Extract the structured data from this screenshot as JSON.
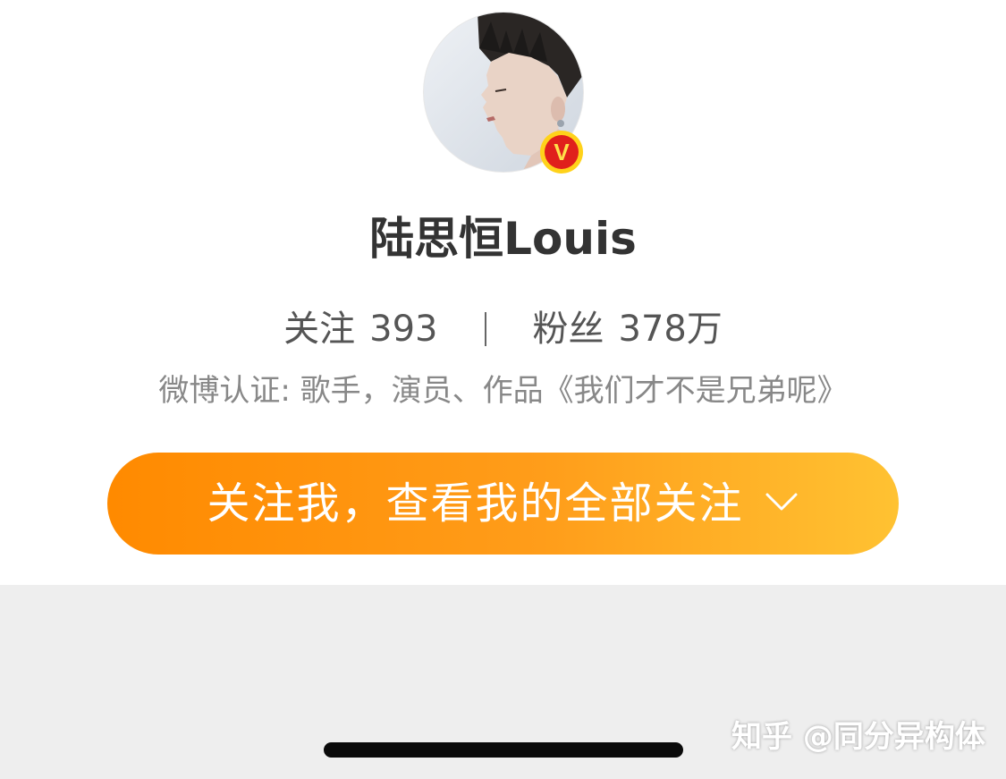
{
  "profile": {
    "name": "陆思恒Louis",
    "verified_badge": "V",
    "following_label": "关注",
    "following_count": "393",
    "followers_label": "粉丝",
    "followers_count": "378万",
    "verification": "微博认证: 歌手，演员、作品《我们才不是兄弟呢》"
  },
  "follow_button": {
    "label": "关注我，查看我的全部关注",
    "icon": "chevron-down-icon"
  },
  "watermark": "知乎 @同分异构体",
  "colors": {
    "button_gradient_start": "#ff8a00",
    "button_gradient_end": "#ffc232",
    "badge_yellow": "#ffd21a",
    "badge_red": "#e0201c",
    "bottom_background": "#eeeeee"
  }
}
